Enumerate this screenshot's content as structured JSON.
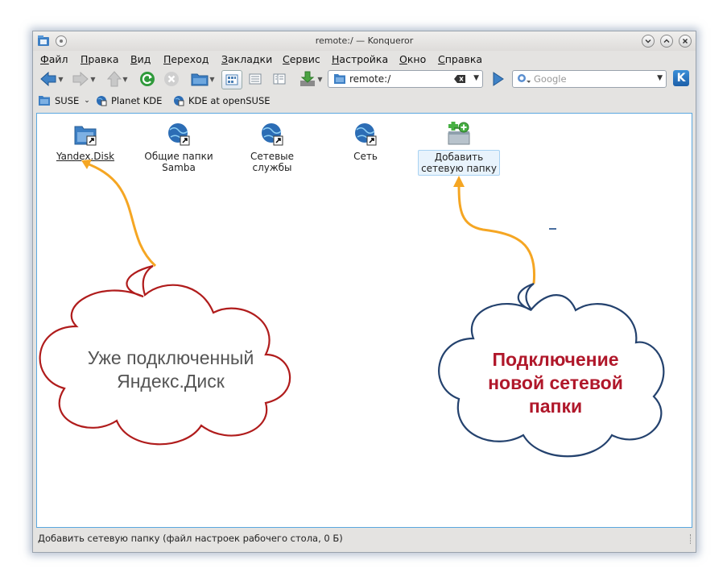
{
  "window": {
    "title": "remote:/ — Konqueror"
  },
  "menu": [
    "Файл",
    "Правка",
    "Вид",
    "Переход",
    "Закладки",
    "Сервис",
    "Настройка",
    "Окно",
    "Справка"
  ],
  "location": {
    "url": "remote:/"
  },
  "search": {
    "placeholder": "Google"
  },
  "bookmarks": [
    "SUSE",
    "Planet KDE",
    "KDE at openSUSE"
  ],
  "items": [
    {
      "name": "Yandex.Disk",
      "icon": "folder-remote-icon"
    },
    {
      "name": "Общие папки Samba",
      "icon": "network-globe-icon"
    },
    {
      "name": "Сетевые службы",
      "icon": "network-globe-icon"
    },
    {
      "name": "Сеть",
      "icon": "network-globe-icon"
    },
    {
      "name": "Добавить сетевую папку",
      "icon": "add-network-folder-icon"
    }
  ],
  "status": {
    "text": "Добавить сетевую папку (файл настроек рабочего стола, 0 Б)"
  },
  "callouts": {
    "left": "Уже подключенный Яндекс.Диск",
    "right": "Подключение новой сетевой папки"
  },
  "colors": {
    "accent": "#5aa7df",
    "arrow": "#f5a623",
    "left_cloud_border": "#b01c1c",
    "right_cloud_border": "#24426e",
    "right_text": "#b0172a",
    "left_text": "#555555"
  }
}
